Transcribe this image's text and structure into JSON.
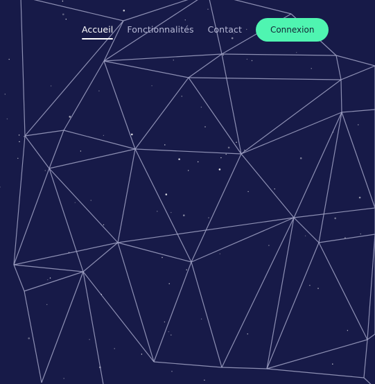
{
  "nav": {
    "links": [
      {
        "label": "Accueil",
        "active": true
      },
      {
        "label": "Fonctionnalités",
        "active": false
      },
      {
        "label": "Contact",
        "active": false
      }
    ],
    "login_label": "Connexion"
  },
  "colors": {
    "background": "#171a48",
    "mesh_lines": "#a3a6c8",
    "accent": "#4ff5b1",
    "nav_text": "#b7b9d6",
    "nav_active": "#ffffff"
  }
}
